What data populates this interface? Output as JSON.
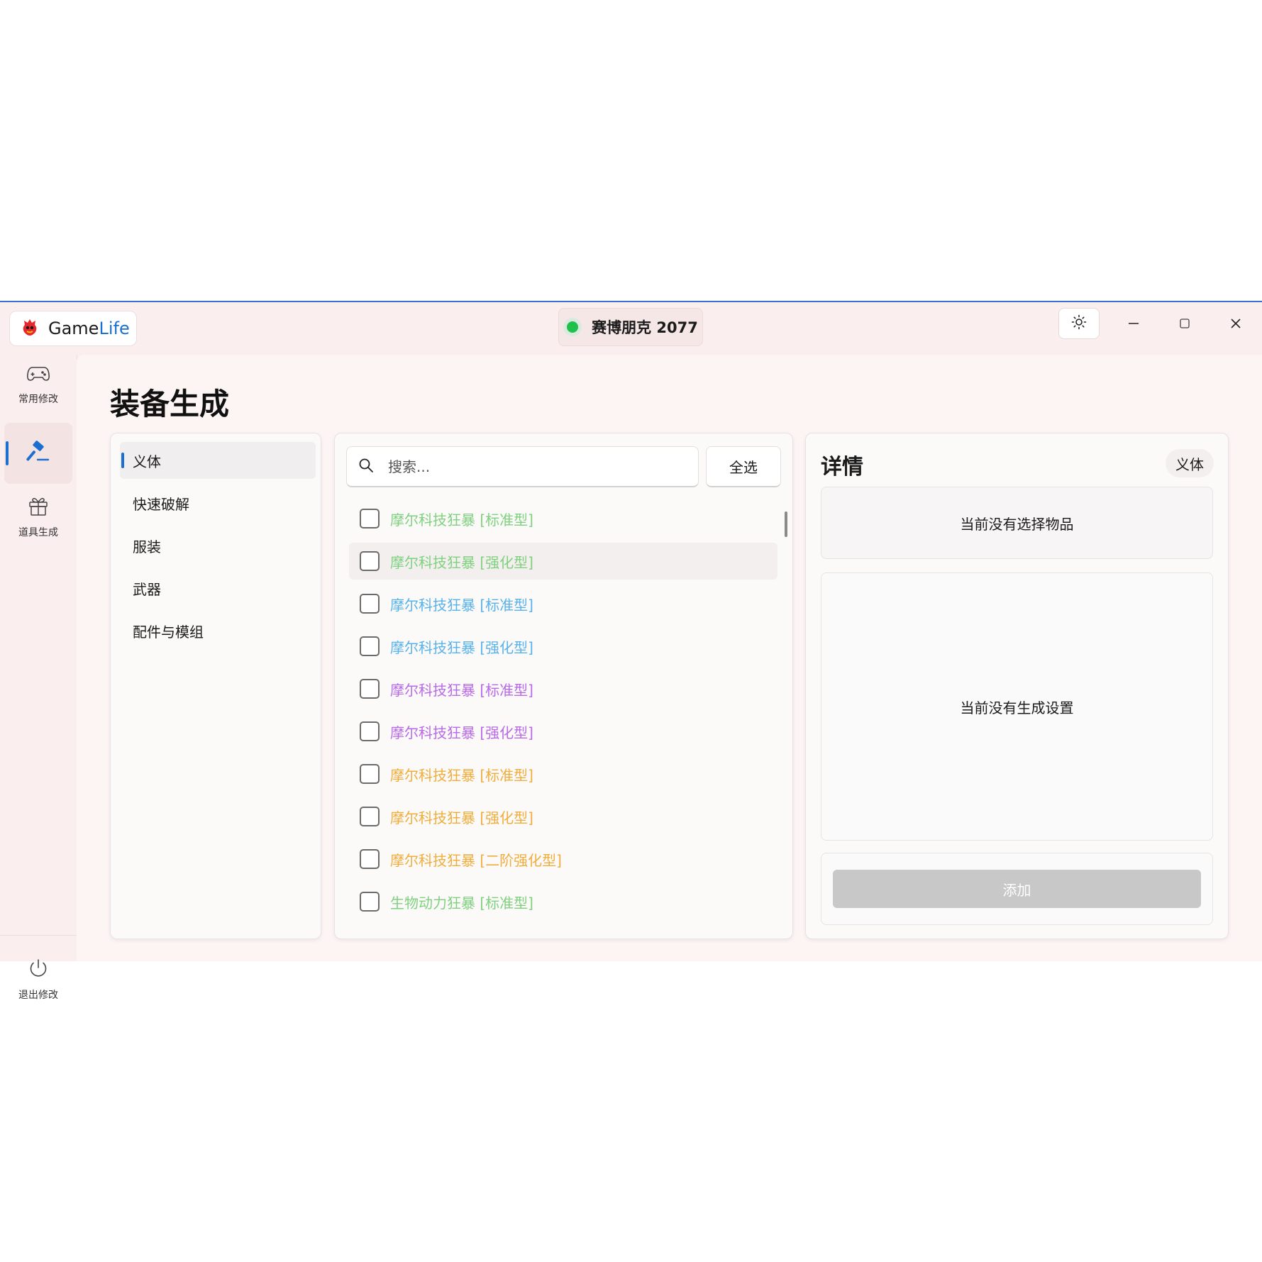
{
  "app": {
    "name_part1": "Game",
    "name_part2": "Life"
  },
  "game": {
    "name": "赛博朋克 2077",
    "status_color": "#21c04a"
  },
  "nav": {
    "items": [
      {
        "label": "常用修改",
        "icon": "gamepad-icon"
      },
      {
        "label": "",
        "icon": "hammer-icon",
        "active": true
      },
      {
        "label": "道具生成",
        "icon": "gift-icon"
      }
    ],
    "exit_label": "退出修改"
  },
  "page": {
    "title": "装备生成"
  },
  "categories": [
    {
      "label": "义体",
      "active": true
    },
    {
      "label": "快速破解"
    },
    {
      "label": "服装"
    },
    {
      "label": "武器"
    },
    {
      "label": "配件与模组"
    }
  ],
  "search": {
    "placeholder": "搜索..."
  },
  "select_all_label": "全选",
  "items": [
    {
      "label": "摩尔科技狂暴 [标准型]",
      "color": "#7fd17f"
    },
    {
      "label": "摩尔科技狂暴 [强化型]",
      "color": "#7fd17f"
    },
    {
      "label": "摩尔科技狂暴 [标准型]",
      "color": "#58b2ec"
    },
    {
      "label": "摩尔科技狂暴 [强化型]",
      "color": "#58b2ec"
    },
    {
      "label": "摩尔科技狂暴 [标准型]",
      "color": "#b96ae8"
    },
    {
      "label": "摩尔科技狂暴 [强化型]",
      "color": "#b96ae8"
    },
    {
      "label": "摩尔科技狂暴 [标准型]",
      "color": "#f0ad3c"
    },
    {
      "label": "摩尔科技狂暴 [强化型]",
      "color": "#f0ad3c"
    },
    {
      "label": "摩尔科技狂暴 [二阶强化型]",
      "color": "#f0ad3c"
    },
    {
      "label": "生物动力狂暴 [标准型]",
      "color": "#7fd17f"
    }
  ],
  "details": {
    "title": "详情",
    "tag": "义体",
    "no_item": "当前没有选择物品",
    "no_settings": "当前没有生成设置",
    "add_label": "添加"
  }
}
